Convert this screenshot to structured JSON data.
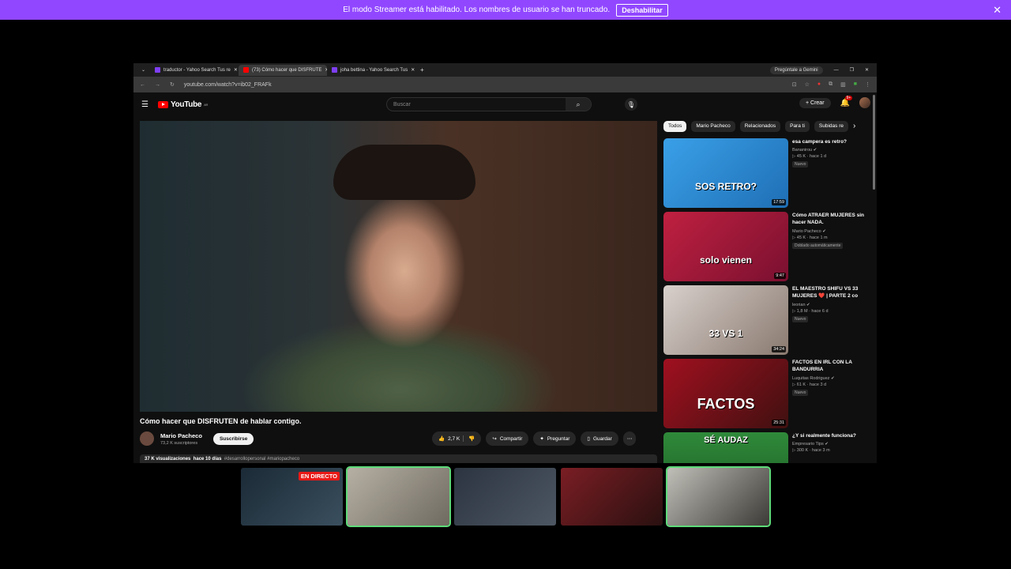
{
  "banner": {
    "message": "El modo Streamer está habilitado. Los nombres de usuario se han truncado.",
    "button": "Deshabilitar",
    "close_icon": "close-icon"
  },
  "tabs": [
    {
      "title": "traductor - Yahoo Search Tus re",
      "color": "#7e3ff2"
    },
    {
      "title": "(73) Cómo hacer que DISFRUTE",
      "color": "#ff0000"
    },
    {
      "title": "joha bettina - Yahoo Search Tus",
      "color": "#7e3ff2"
    }
  ],
  "browser": {
    "gemini": "Pregúntale a Gemini",
    "url": "youtube.com/watch?v=ib02_FRAFk"
  },
  "youtube": {
    "logo": "YouTube",
    "region": "AR",
    "search_placeholder": "Buscar",
    "create": "Crear",
    "notif_count": "9+"
  },
  "video": {
    "title": "Cómo hacer que DISFRUTEN de hablar contigo.",
    "channel": "Mario Pacheco",
    "subscribers": "73,2 K suscriptores",
    "subscribe": "Suscribirse",
    "likes": "2,7 K",
    "share": "Compartir",
    "ask": "Preguntar",
    "save": "Guardar",
    "views": "37 K visualizaciones",
    "date": "hace 10 días",
    "tags": "#desarrollopersonal #mariopacheco"
  },
  "chips": [
    "Todos",
    "Mario Pacheco",
    "Relacionados",
    "Para ti",
    "Subidas re"
  ],
  "recommendations": [
    {
      "title": "esa campera es retro?",
      "channel": "Bananirou",
      "views": "45 K",
      "age": "hace 1 d",
      "badge": "Nuevo",
      "duration": "17:59",
      "thumb_text": "SOS RETRO?",
      "bg": "linear-gradient(135deg,#3aa0e8,#1f6fb5)"
    },
    {
      "title": "Cómo ATRAER MUJERES sin hacer NADA.",
      "channel": "Mario Pacheco",
      "views": "45 K",
      "age": "hace 1 m",
      "badge": "Doblado automáticamente",
      "duration": "9:47",
      "thumb_text": "solo vienen",
      "bg": "linear-gradient(135deg,#c02040,#7a1030)"
    },
    {
      "title": "EL MAESTRO SHIFU VS 33 MUJERES ❤️ | PARTE 2 co",
      "channel": "leorian",
      "views": "1,8 M",
      "age": "hace 6 d",
      "badge": "Nuevo",
      "duration": "34:24",
      "thumb_text": "33 VS 1",
      "bg": "linear-gradient(135deg,#d8d0cc,#8a7a70)"
    },
    {
      "title": "FACTOS EN IRL CON LA BANDURRIA",
      "channel": "Luquitas Rodriguez",
      "views": "61 K",
      "age": "hace 3 d",
      "badge": "Nuevo",
      "duration": "25:31",
      "thumb_text": "FACTOS",
      "bg": "linear-gradient(135deg,#a01020,#401010)"
    },
    {
      "title": "¿Y si realmente funciona?",
      "channel": "Empresario Tips",
      "views": "300 K",
      "age": "hace 3 m",
      "badge": "",
      "duration": "",
      "thumb_text": "SÉ AUDAZ",
      "bg": "linear-gradient(180deg,#2f8a3a,#1d5e26)"
    }
  ],
  "cams": [
    {
      "label": "EN DIRECTO",
      "bg": "linear-gradient(135deg,#1b2a36,#3a4f5e)",
      "active": false
    },
    {
      "label": "",
      "bg": "linear-gradient(135deg,#b6b0a4,#6f6a60)",
      "active": true
    },
    {
      "label": "",
      "bg": "linear-gradient(135deg,#2b3440,#4d5763)",
      "active": false
    },
    {
      "label": "",
      "bg": "linear-gradient(135deg,#7a1e24,#2a1010)",
      "active": false
    },
    {
      "label": "",
      "bg": "linear-gradient(135deg,#c0bfb8,#3c3a36)",
      "active": true
    }
  ]
}
